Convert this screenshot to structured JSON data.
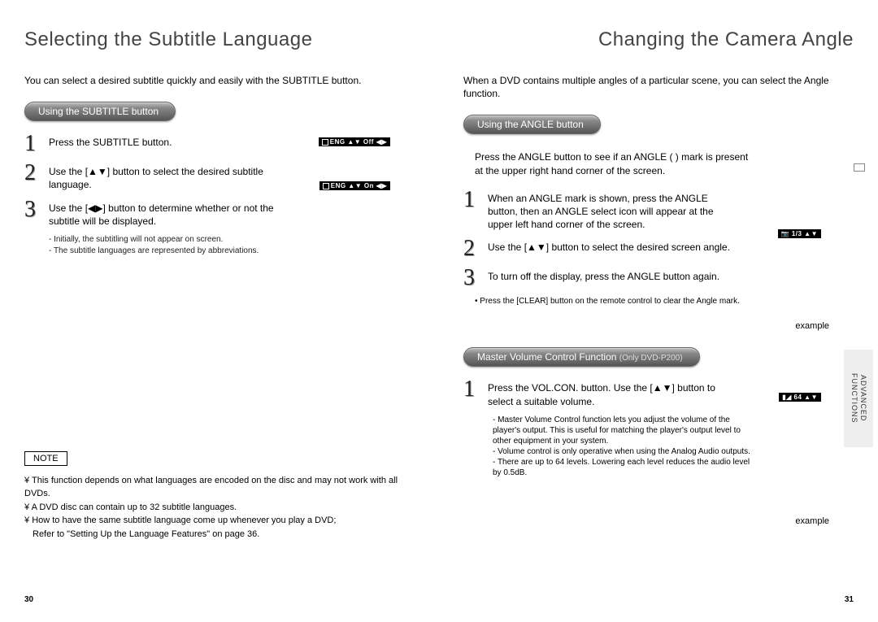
{
  "left": {
    "title": "Selecting the Subtitle Language",
    "intro": "You can select a desired subtitle quickly and easily with the SUBTITLE button.",
    "pill": "Using the SUBTITLE button",
    "steps": [
      {
        "n": "1",
        "text": "Press the SUBTITLE button."
      },
      {
        "n": "2",
        "text": "Use the [▲▼] button to select the desired subtitle language."
      },
      {
        "n": "3",
        "text": "Use the [◀▶] button to determine whether or not the subtitle will be displayed."
      }
    ],
    "osd1": "ENG ▲▼ Off ◀▶",
    "osd2": "ENG ▲▼ On ◀▶",
    "mini_notes": [
      "Initially, the subtitling will not appear on screen.",
      "The subtitle languages are represented by abbreviations."
    ],
    "note_label": "NOTE",
    "notes": [
      "This function depends on what languages are encoded on the disc and may not work with all DVDs.",
      "A DVD disc can contain up to 32 subtitle languages.",
      "How to have the same subtitle language come up whenever you play  a DVD;"
    ],
    "note_refer": "Refer to \"Setting Up the Language Features\" on page 36.",
    "page_num": "30"
  },
  "right": {
    "title": "Changing the Camera Angle",
    "intro": "When a DVD contains multiple angles of a particular scene, you can select the Angle function.",
    "pill1": "Using the ANGLE button",
    "pre_step": "Press the ANGLE button to see if an ANGLE (        ) mark is present at the upper right hand corner of the screen.",
    "steps1": [
      {
        "n": "1",
        "text": "When an ANGLE mark is shown, press the ANGLE button, then an ANGLE select icon will appear at the upper left hand corner of the screen."
      },
      {
        "n": "2",
        "text": "Use the [▲▼] button to select the desired screen angle."
      },
      {
        "n": "3",
        "text": "To turn off the display, press the ANGLE button again."
      }
    ],
    "osd_angle": "1/3 ▲▼",
    "clear_note": "Press the [CLEAR] button on the remote control to clear the Angle mark.",
    "example1": "example",
    "pill2": "Master Volume Control Function",
    "pill2_sub": "(Only DVD-P200)",
    "steps2": [
      {
        "n": "1",
        "text": "Press the VOL.CON. button. Use the [▲▼] button to select a suitable volume."
      }
    ],
    "osd_vol": "64 ▲▼",
    "vol_notes": [
      "Master Volume Control function lets you adjust the volume of the player's output. This is useful for matching the player's output level to other equipment in your system.",
      "Volume control is only operative when using the Analog Audio outputs.",
      "There are up to 64 levels. Lowering each level reduces the audio level by 0.5dB."
    ],
    "example2": "example",
    "side_tab": "ADVANCED FUNCTIONS",
    "page_num": "31"
  }
}
